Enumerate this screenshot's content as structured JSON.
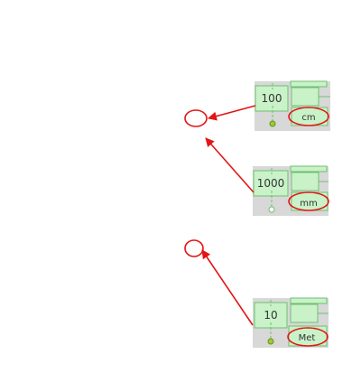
{
  "colors": {
    "widget_fill": "#c9f2c9",
    "widget_stroke": "#6fbf6f",
    "annotation": "#e31515",
    "background": "#ffffff"
  },
  "widgets": [
    {
      "value": "100",
      "unit": "cm",
      "indicator": "filled"
    },
    {
      "value": "1000",
      "unit": "mm",
      "indicator": "hollow"
    },
    {
      "value": "10",
      "unit": "Met",
      "indicator": "filled"
    }
  ],
  "annotations": {
    "arrow_count": 3,
    "target_circle_count": 2
  }
}
